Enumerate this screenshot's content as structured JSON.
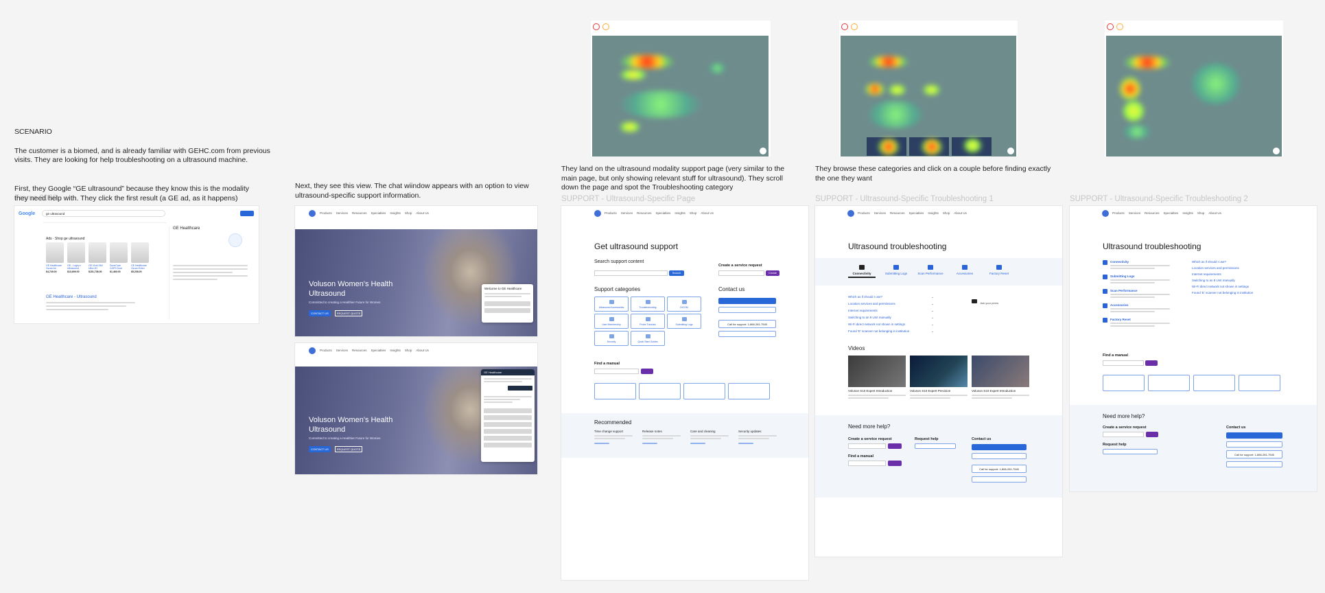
{
  "scenario": {
    "title": "SCENARIO",
    "text": "The customer is a biomed, and is already familiar with GEHC.com from previous visits. They are looking for help troubleshooting on a ultrasound machine."
  },
  "steps": {
    "step1": "First, they Google “GE ultrasound” because they know this is the modality they need help with. They click the first result (a GE ad, as it happens)",
    "step1_overlap_label": "Frame 3000",
    "step2": "Next, they see this view. The chat wiindow appears with an option to view ultrasound-specific support information.",
    "step3": "They land on the ultrasound modality support page (very similar to the main page, but only showing relevant stuff for ultrasound). They scroll down the page and spot the Troubleshooting category",
    "step4": "They browse these categories and click on a couple before finding exactly the one they want"
  },
  "frame_labels": {
    "support_page": "SUPPORT - Ultrasound-Specific Page",
    "troubleshooting1": "SUPPORT - Ultrasound-Specific Troubleshooting 1",
    "troubleshooting2": "SUPPORT - Ultrasound-Specific Troubleshooting 2"
  },
  "google": {
    "logo": "Google",
    "query": "ge ultrasound",
    "shop_header": "Ads · Shop ge ultrasound",
    "result_title": "GE Healthcare - Ultrasound",
    "panel_title": "GE Healthcare",
    "products": [
      {
        "name": "GE Healthcare Vscan Air",
        "price": "$4,749.00"
      },
      {
        "name": "GE - Logiq e Ultrasound",
        "price": "$13,699.00"
      },
      {
        "name": "GE Vivid S60 Ultra 2D",
        "price": "$151,738.00"
      },
      {
        "name": "DonnCare CAPS Dual",
        "price": "$1,460.00"
      },
      {
        "name": "GE Healthcare Vscan Exten",
        "price": "$5,208.00"
      }
    ]
  },
  "hero": {
    "title": "Voluson Women's Health Ultrasound",
    "subtitle": "Committed to creating a Healthier Future for Women",
    "cta1": "CONTACT US",
    "cta2": "REQUEST QUOTE",
    "chat_title": "Welcome to GE Healthcare",
    "chat_title2": "GE Healthcare"
  },
  "nav_items": [
    "Products",
    "Services",
    "Resources",
    "Specialties",
    "Insights",
    "Shop",
    "About Us"
  ],
  "support": {
    "title": "Get ultrasound support",
    "search_label": "Search support content",
    "search_btn": "Search",
    "service_label": "Create a service request",
    "create_btn": "Create",
    "categories_label": "Support categories",
    "categories": [
      "Ultrasound Accessories",
      "Troubleshooting",
      "DICOM",
      "User Membership",
      "Probe Tutorials",
      "Submitting Logs",
      "Security",
      "Quick Start Guides"
    ],
    "contact_label": "Contact us",
    "call": "Call for support: 1-866-281-7545",
    "manual_label": "Find a manual",
    "recommended": "Recommended",
    "rec_items": [
      "Time change support",
      "Release notes",
      "Care and cleaning",
      "Security updates"
    ]
  },
  "troubleshooting": {
    "title": "Ultrasound troubleshooting",
    "tabs": [
      "Connectivity",
      "Submitting Logs",
      "Scan Performance",
      "Accessories",
      "Factory Reset"
    ],
    "faq": [
      "Which as if should I use?",
      "Location services and permissions",
      "Internet requirements",
      "Switching to an 8 Unit manually",
      "Wi-Fi direct network not shown in settings",
      "Found 'E' scanner not belonging in institution"
    ],
    "ask": "Ask your peers",
    "videos": "Videos",
    "video_titles": [
      "Voluson S10 Expert Introduction",
      "Voluson S10 Expert Precision",
      "Voluson S10 Expert Introduction"
    ],
    "more_help": "Need more help?",
    "request_help": "Request help",
    "manual": "Find a manual",
    "contact": "Contact us",
    "call": "Call for support: 1-866-281-7545"
  }
}
